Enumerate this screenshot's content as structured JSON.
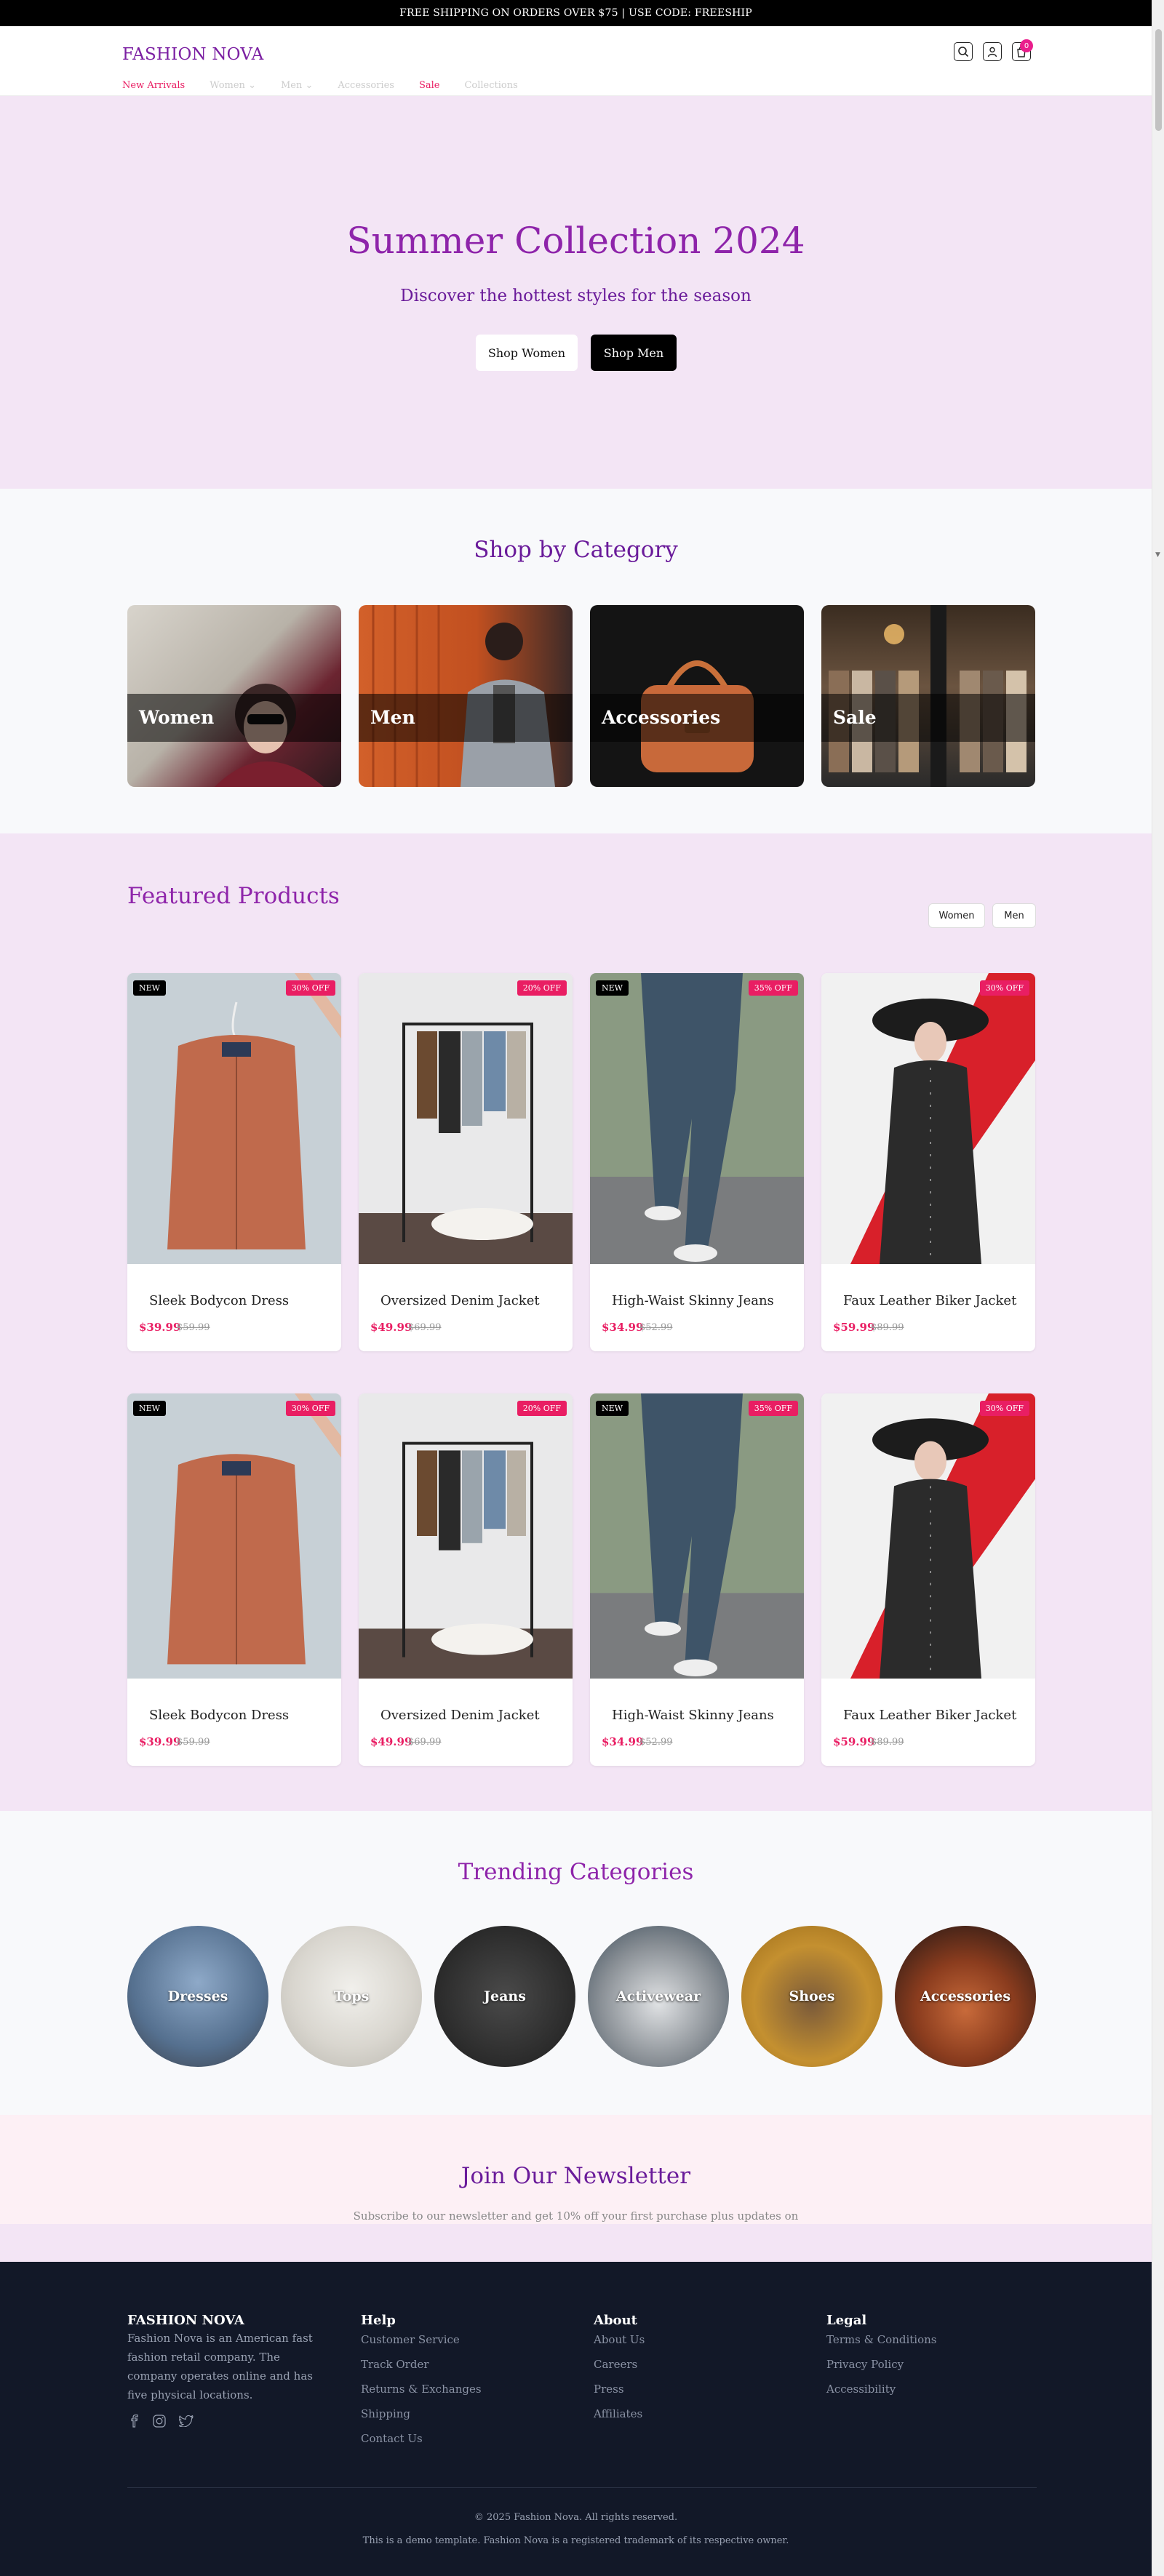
{
  "announcement": "FREE SHIPPING ON ORDERS OVER $75 | USE CODE: FREESHIP",
  "header": {
    "logo": "FASHION NOVA",
    "cart_count": "0",
    "nav": [
      "New Arrivals",
      "Women",
      "Men",
      "Accessories",
      "Sale",
      "Collections"
    ]
  },
  "hero": {
    "title": "Summer Collection 2024",
    "subtitle": "Discover the hottest styles for the season",
    "btn_women": "Shop Women",
    "btn_men": "Shop Men"
  },
  "categories": {
    "title": "Shop by Category",
    "items": [
      "Women",
      "Men",
      "Accessories",
      "Sale"
    ]
  },
  "featured": {
    "title": "Featured Products",
    "filters": [
      "Women",
      "Men"
    ],
    "badge_new": "NEW",
    "products": [
      {
        "name": "Sleek Bodycon Dress",
        "price": "$39.99",
        "old_price": "$59.99",
        "discount": "30% OFF"
      },
      {
        "name": "Oversized Denim Jacket",
        "price": "$49.99",
        "old_price": "$69.99",
        "discount": "20% OFF"
      },
      {
        "name": "High-Waist Skinny Jeans",
        "price": "$34.99",
        "old_price": "$52.99",
        "discount": "35% OFF"
      },
      {
        "name": "Faux Leather Biker Jacket",
        "price": "$59.99",
        "old_price": "$89.99",
        "discount": "30% OFF"
      }
    ]
  },
  "trending": {
    "title": "Trending Categories",
    "items": [
      "Dresses",
      "Tops",
      "Jeans",
      "Activewear",
      "Shoes",
      "Accessories"
    ]
  },
  "newsletter": {
    "title": "Join Our Newsletter",
    "subtitle": "Subscribe to our newsletter and get 10% off your first purchase plus updates on"
  },
  "footer": {
    "brand": "FASHION NOVA",
    "about": "Fashion Nova is an American fast fashion retail company. The company operates online and has five physical locations.",
    "help_title": "Help",
    "help": [
      "Customer Service",
      "Track Order",
      "Returns & Exchanges",
      "Shipping",
      "Contact Us"
    ],
    "about_title": "About",
    "about_links": [
      "About Us",
      "Careers",
      "Press",
      "Affiliates"
    ],
    "legal_title": "Legal",
    "legal": [
      "Terms & Conditions",
      "Privacy Policy",
      "Accessibility"
    ],
    "copyright": "© 2025 Fashion Nova. All rights reserved.",
    "disclaimer": "This is a demo template. Fashion Nova is a registered trademark of its respective owner."
  },
  "colors": {
    "accent": "#8e24aa",
    "sale": "#e91e63",
    "hero_bg": "#f3e5f5",
    "footer_bg": "#121828"
  }
}
